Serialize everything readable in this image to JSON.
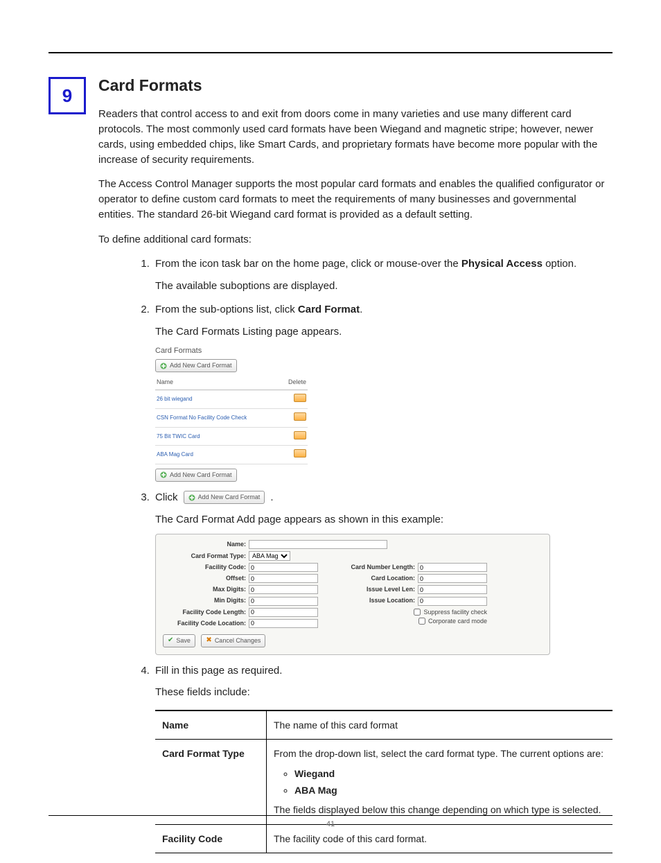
{
  "chapter_number": "9",
  "title": "Card Formats",
  "para1": "Readers that control access to and exit from doors come in many varieties and use many different card protocols. The most commonly used card formats have been Wiegand and magnetic stripe; however, newer cards, using embedded chips, like Smart Cards, and proprietary formats have become more popular with the increase of security requirements.",
  "para2": "The Access Control Manager supports the most popular card formats and enables the qualified configurator or operator to define custom card formats to meet the requirements of many businesses and governmental entities. The standard 26-bit Wiegand card format is provided as a default setting.",
  "para3": "To define additional card formats:",
  "steps": {
    "s1a": "From the icon task bar on the home page, click or mouse-over the ",
    "s1b": "Physical Access",
    "s1c": " option.",
    "s1d": "The available suboptions are displayed.",
    "s2a": "From the sub-options list, click ",
    "s2b": "Card Format",
    "s2c": ".",
    "s2d": "The Card Formats Listing page appears.",
    "s3a": "Click ",
    "s3b": ".",
    "s3c": "The Card Format Add page appears as shown in this example:",
    "s4a": "Fill in this page as required.",
    "s4b": "These fields include:"
  },
  "listing": {
    "title": "Card Formats",
    "add_label": "Add New Card Format",
    "col_name": "Name",
    "col_delete": "Delete",
    "rows": [
      "26 bit wiegand",
      "CSN Format No Facility Code Check",
      "75 Bit TWIC Card",
      "ABA Mag Card"
    ]
  },
  "form": {
    "name_lbl": "Name:",
    "type_lbl": "Card Format Type:",
    "type_val": "ABA Mag",
    "facility_code_lbl": "Facility Code:",
    "offset_lbl": "Offset:",
    "max_digits_lbl": "Max Digits:",
    "min_digits_lbl": "Min Digits:",
    "fac_len_lbl": "Facility Code Length:",
    "fac_loc_lbl": "Facility Code Location:",
    "card_num_len_lbl": "Card Number Length:",
    "card_loc_lbl": "Card Location:",
    "issue_len_lbl": "Issue Level Len:",
    "issue_loc_lbl": "Issue Location:",
    "suppress_lbl": "Suppress facility check",
    "corporate_lbl": "Corporate card mode",
    "zero": "0",
    "save": "Save",
    "cancel": "Cancel Changes"
  },
  "desc_table": {
    "r1_name": "Name",
    "r1_desc": "The name of this card format",
    "r2_name": "Card Format Type",
    "r2_desc_a": "From the drop-down list, select the card format type. The current options are:",
    "r2_opt1": "Wiegand",
    "r2_opt2": "ABA Mag",
    "r2_desc_b": "The fields displayed below this change depending on which type is selected.",
    "r3_name": "Facility Code",
    "r3_desc": "The facility code of this card format."
  },
  "page_number": "41"
}
